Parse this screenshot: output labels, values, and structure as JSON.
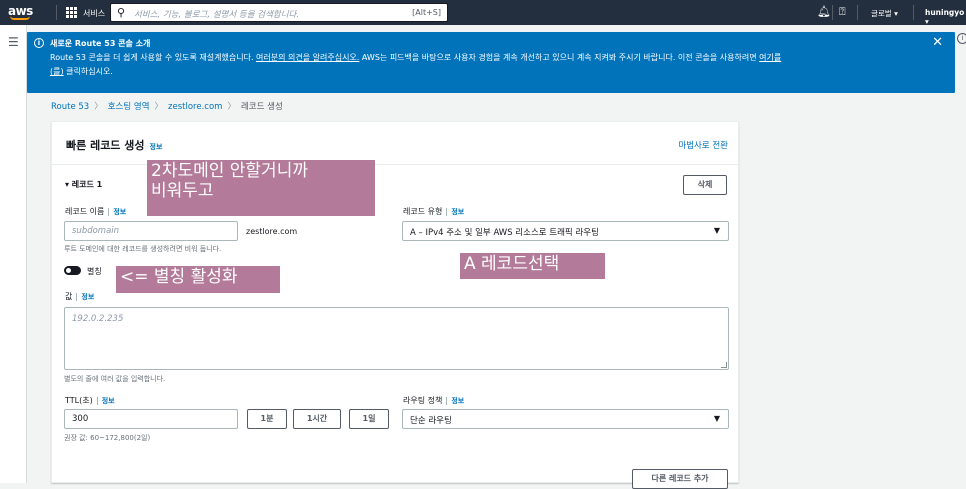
{
  "topbar": {
    "logo": "aws",
    "services": "서비스",
    "search_placeholder": "서비스, 기능, 블로그, 설명서 등을 검색합니다.",
    "search_shortcut": "[Alt+S]",
    "region": "글로벌 ▾",
    "user": "huningyo ▾"
  },
  "flash": {
    "title": "새로운 Route 53 콘솔 소개",
    "body_pre": "Route 53 콘솔을 더 쉽게 사용할 수 있도록 재설계했습니다. ",
    "body_link1": "여러분의 의견을 알려주십시오.",
    "body_mid": " AWS는 피드백을 바탕으로 사용자 경험을 계속 개선하고 있으니 계속 지켜봐 주시기 바랍니다. 이전 콘솔을 사용하려면 ",
    "body_link2": "여기를",
    "body_link3": "(를)",
    "body_post": " 클릭하십시오."
  },
  "breadcrumb": [
    "Route 53",
    "호스팅 영역",
    "zestlore.com",
    "레코드 생성"
  ],
  "panel": {
    "title": "빠른 레코드 생성",
    "info": "정보",
    "wizard_link": "마법사로 전환",
    "record_header": "▾ 레코드 1",
    "delete": "삭제",
    "record_name_label": "레코드 이름",
    "record_name_placeholder": "subdomain",
    "domain_suffix": "zestlore.com",
    "record_name_hint": "루트 도메인에 대한 레코드를 생성하려면 비워 둡니다.",
    "record_type_label": "레코드 유형",
    "record_type_value": "A – IPv4 주소 및 일부 AWS 리소스로 트래픽 라우팅",
    "alias_label": "별칭",
    "value_label": "값",
    "value_placeholder": "192.0.2.235",
    "value_hint": "별도의 줄에 여러 값을 입력합니다.",
    "ttl_label": "TTL(초)",
    "ttl_value": "300",
    "ttl_btn_1m": "1분",
    "ttl_btn_1h": "1시간",
    "ttl_btn_1d": "1일",
    "ttl_hint": "권장 값: 60~172,800(2일)",
    "routing_label": "라우팅 정책",
    "routing_value": "단순 라우팅",
    "add_record": "다른 레코드 추가"
  },
  "annotations": {
    "a1": "2차도메인 안할거니까",
    "a2": "비워두고",
    "a3": "<= 별칭 활성화",
    "a4": "A 레코드선택"
  },
  "colors": {
    "topbar": "#232f3e",
    "flash": "#0073bb",
    "link": "#0073bb",
    "annotation": "#ac7090"
  }
}
